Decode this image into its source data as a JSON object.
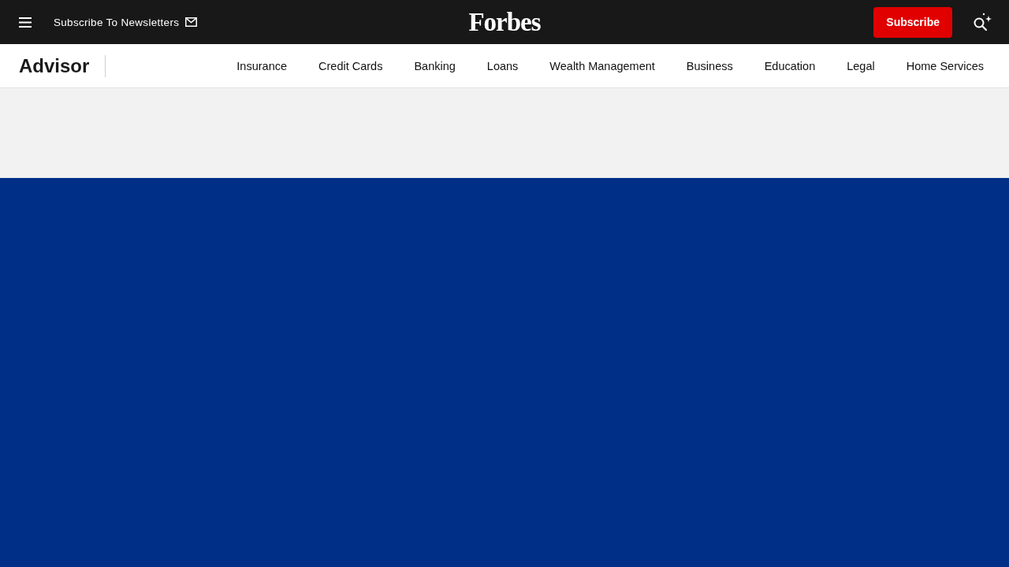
{
  "top_bar": {
    "newsletter_link": "Subscribe To Newsletters",
    "logo": "Forbes",
    "subscribe_button": "Subscribe"
  },
  "advisor_nav": {
    "brand": "Advisor",
    "items": [
      "Insurance",
      "Credit Cards",
      "Banking",
      "Loans",
      "Wealth Management",
      "Business",
      "Education",
      "Legal",
      "Home Services"
    ]
  }
}
